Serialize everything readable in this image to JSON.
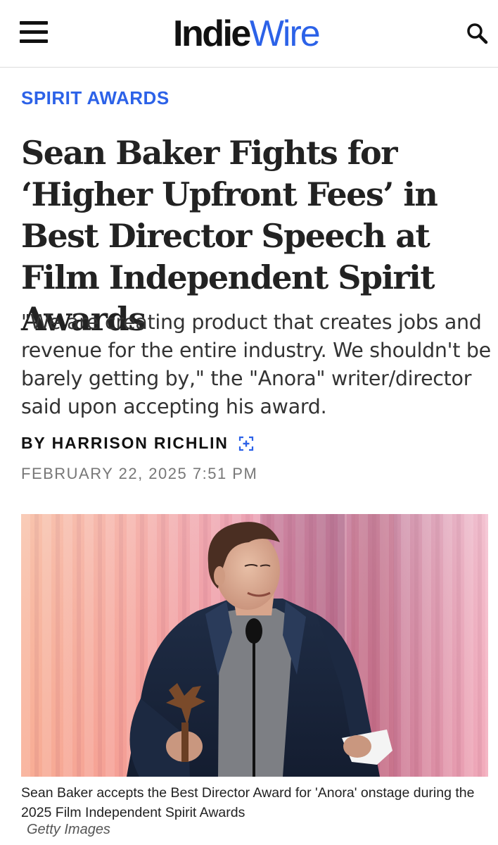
{
  "header": {
    "menu_icon": "hamburger-menu-icon",
    "logo_part1": "Indie",
    "logo_part2": "Wire",
    "search_icon": "search-icon",
    "accent_color": "#2c62e8"
  },
  "article": {
    "kicker": "SPIRIT AWARDS",
    "headline": "Sean Baker Fights for ‘Higher Upfront Fees’ in Best Director Speech at Film Independent Spirit Awards",
    "dek": "\"We are creating product that creates jobs and revenue for the entire industry. We shouldn't be barely getting by,\" the \"Anora\" writer/director said upon accepting his award.",
    "byline_prefix": "BY",
    "author": "HARRISON RICHLIN",
    "follow_icon": "follow-author-icon",
    "timestamp": "FEBRUARY 22, 2025 7:51 PM"
  },
  "image": {
    "caption": "Sean Baker accepts the Best Director Award for 'Anora' onstage during the 2025 Film Independent Spirit Awards",
    "credit": "Getty Images"
  }
}
